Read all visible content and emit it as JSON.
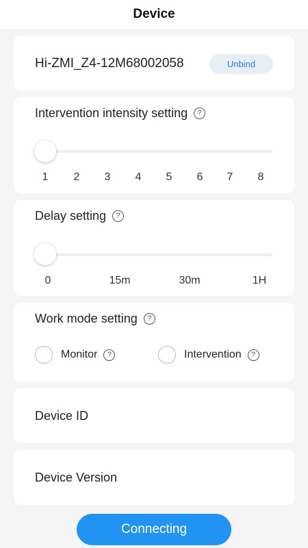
{
  "header": {
    "title": "Device"
  },
  "device": {
    "name": "Hi-ZMI_Z4-12M68002058",
    "unbind_label": "Unbind"
  },
  "intensity": {
    "title": "Intervention intensity setting",
    "help_icon": "?",
    "value": 1,
    "min": 1,
    "max": 8,
    "ticks": [
      "1",
      "2",
      "3",
      "4",
      "5",
      "6",
      "7",
      "8"
    ]
  },
  "delay": {
    "title": "Delay setting",
    "help_icon": "?",
    "value": "0",
    "ticks": [
      "0",
      "15m",
      "30m",
      "1H"
    ]
  },
  "work_mode": {
    "title": "Work mode setting",
    "help_icon": "?",
    "options": [
      {
        "label": "Monitor",
        "help_icon": "?",
        "selected": false
      },
      {
        "label": "Intervention",
        "help_icon": "?",
        "selected": false
      }
    ]
  },
  "device_id": {
    "label": "Device ID"
  },
  "device_version": {
    "label": "Device Version"
  },
  "connect_button": {
    "label": "Connecting"
  },
  "colors": {
    "accent": "#2193f3",
    "unbind_text": "#2d7de1",
    "unbind_bg": "#e8eef6",
    "background": "#f5f5f5",
    "card": "#ffffff"
  }
}
